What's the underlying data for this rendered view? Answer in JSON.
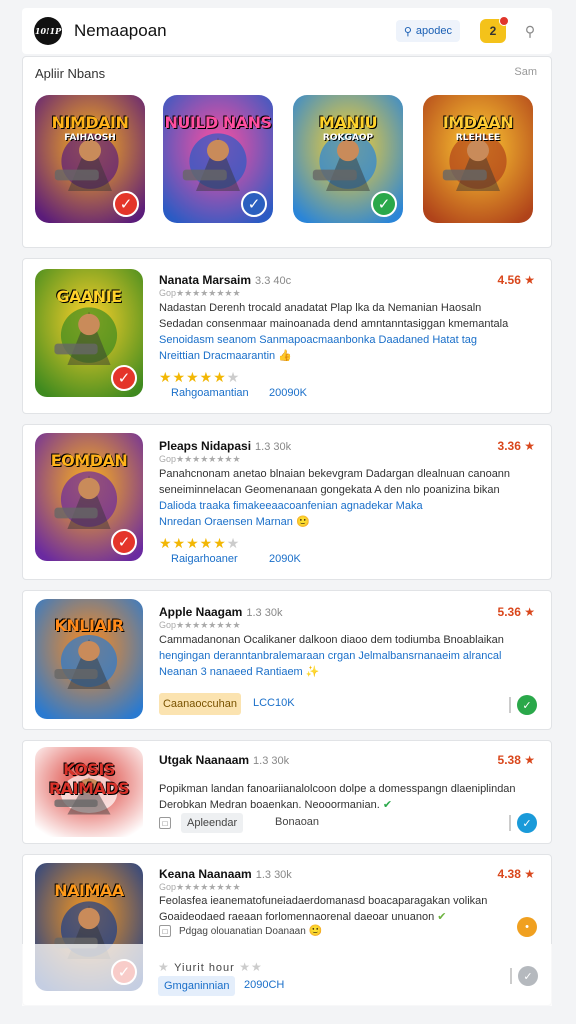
{
  "header": {
    "logo_text": "10!1P",
    "title": "Nemaapoan",
    "search_label": "apodec",
    "notif_count": "2",
    "search_icon": "magnifier-icon"
  },
  "featured": {
    "title": "Apliir Nbans",
    "link": "Sam",
    "items": [
      {
        "label": "NIMDAIN",
        "sub": "FAIHAOSH",
        "bg": "#5b1c7a",
        "accent": "#ffb31a",
        "badge": "red"
      },
      {
        "label": "NUILD NANS",
        "sub": "",
        "bg": "#2a5bc4",
        "accent": "#ff4fa0",
        "badge": "blue"
      },
      {
        "label": "MANIU",
        "sub": "ROKGAOP",
        "bg": "#2a85d8",
        "accent": "#ffd22a",
        "badge": "green"
      },
      {
        "label": "IMDAAN",
        "sub": "RLEHLEE",
        "bg": "#b0431a",
        "accent": "#ffcc33",
        "badge": "none"
      }
    ]
  },
  "cards": [
    {
      "name": "Nanata Marsaim",
      "size": "3.3 40c",
      "price": "4.56",
      "sub": "Gop★★★★★★★★",
      "desc": [
        "Nadastan Derenh trocald anadatat Plap lka da Nemanian Haosaln",
        "Sedadan consenmaar mainoanada dend amntanntasiggan kmemantala",
        "Senoidasm seanom Sanmapoacmaanbonka Daadaned Hatat tag",
        "Nreittian Dracmaarantin"
      ],
      "rating": "4.5",
      "tag1": "Rahgoamantian",
      "tag2": "20090K",
      "icon_label": "GAANIE",
      "icon_bg": "#3f8a1f",
      "icon_accent": "#ffd22a"
    },
    {
      "name": "Pleaps Nidapasi",
      "size": "1.3 30k",
      "price": "3.36",
      "sub": "Gop★★★★★★★★",
      "desc": [
        "Panahcnonam anetao blnaian bekevgram Dadargan dlealnuan canoann",
        "seneiminnelacan Geomenanaan gongekata A den nlo poanizina bikan",
        "Dalioda traaka fimakeeaacoanfenian agnadekar Maka",
        "Nnredan Oraensen Marnan"
      ],
      "rating": "4.5",
      "tag1": "Raigarhoaner",
      "tag2": "2090K",
      "icon_label": "EOMDAN",
      "icon_bg": "#6a2aa0",
      "icon_accent": "#ffb31a"
    },
    {
      "name": "Apple Naagam",
      "size": "1.3 30k",
      "price": "5.36",
      "sub": "Gop★★★★★★★★",
      "desc": [
        "Cammadanonan Ocalikaner dalkoon diaoo dem todiumba Bnoablaikan",
        "hengingan deranntanbralemaraan crgan Jelmalbansrnanaeim alrancal",
        "Neanan 3 nanaeed Rantiaem"
      ],
      "pill": "Caanaoccuhan",
      "tag2": "LCC10K",
      "icon_label": "KNLIAIR",
      "icon_bg": "#2a7ad0",
      "icon_accent": "#ff8a1a"
    },
    {
      "name": "Utgak Naanaam",
      "size": "1.3 30k",
      "price": "5.38",
      "sub": "",
      "desc": [
        "Popikman landan fanoariianalolcoon dolpe a domesspangn dlaeniplindan",
        "Derobkan Medran boaenkan. Neooormanian."
      ],
      "pill": "Apleendar",
      "tag2": "Bonaoan",
      "icon_label": "KOSIS RAIMADS",
      "icon_bg": "#ffffff",
      "icon_accent": "#d9322a"
    },
    {
      "name": "Keana Naanaam",
      "size": "1.3 30k",
      "price": "4.38",
      "sub": "Gop★★★★★★★★",
      "desc": [
        "Feolasfea ieanematofuneiadaerdomanasd boacaparagakan volikan",
        "Goaideodaed raeaan forlomennaorenal daeoar unuanon"
      ],
      "pill": "Pdgag olouanatian Doanaan",
      "footer_stars": "Yiurit hour",
      "footer_pill": "Gmganinnian",
      "footer_tag": "2090CH",
      "icon_label": "NAIMAA",
      "icon_bg": "#1b3e8a",
      "icon_accent": "#ff9a1a"
    }
  ]
}
